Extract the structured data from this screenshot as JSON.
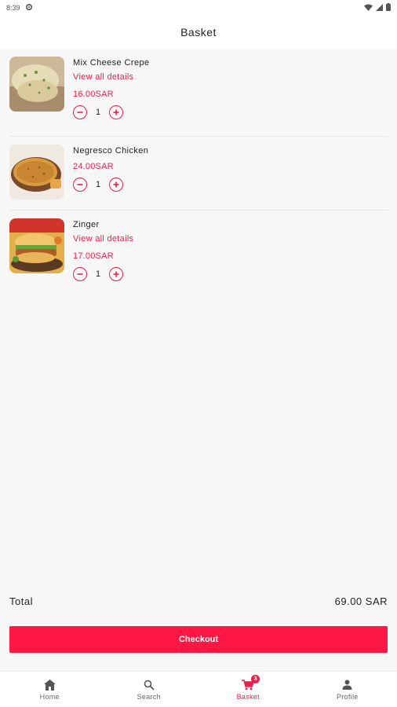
{
  "status_bar": {
    "time": "8:39"
  },
  "header": {
    "title": "Basket"
  },
  "items": [
    {
      "name": "Mix Cheese Crepe",
      "details_label": "View all details",
      "price": "16.00SAR",
      "qty": "1"
    },
    {
      "name": "Negresco Chicken",
      "price": "24.00SAR",
      "qty": "1"
    },
    {
      "name": "Zinger",
      "details_label": "View all details",
      "price": "17.00SAR",
      "qty": "1"
    }
  ],
  "summary": {
    "total_label": "Total",
    "total_value": "69.00 SAR",
    "checkout_label": "Checkout"
  },
  "nav": {
    "items": [
      {
        "label": "Home",
        "icon": "home-icon"
      },
      {
        "label": "Search",
        "icon": "search-icon"
      },
      {
        "label": "Basket",
        "icon": "cart-icon",
        "badge": "3"
      },
      {
        "label": "Profile",
        "icon": "person-icon"
      }
    ],
    "active": "Basket"
  },
  "colors": {
    "accent": "#ee1f4a",
    "checkout_bg": "#ff1744"
  }
}
